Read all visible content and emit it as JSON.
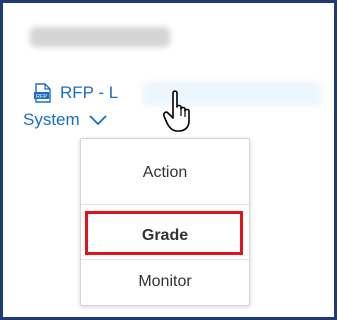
{
  "header": {
    "title_prefix": "RFP - L",
    "title_line2": "System",
    "doc_icon_label": "RFP",
    "doc_icon_name": "rfp-document-icon",
    "chevron_icon_name": "chevron-down-icon",
    "cursor_icon_name": "hand-pointer-icon"
  },
  "menu": {
    "items": [
      {
        "label": "Action"
      },
      {
        "label": "Grade"
      },
      {
        "label": "Monitor"
      }
    ]
  },
  "colors": {
    "link": "#1a6ec6",
    "highlight": "#e2131a",
    "frame": "#1f3b70"
  }
}
